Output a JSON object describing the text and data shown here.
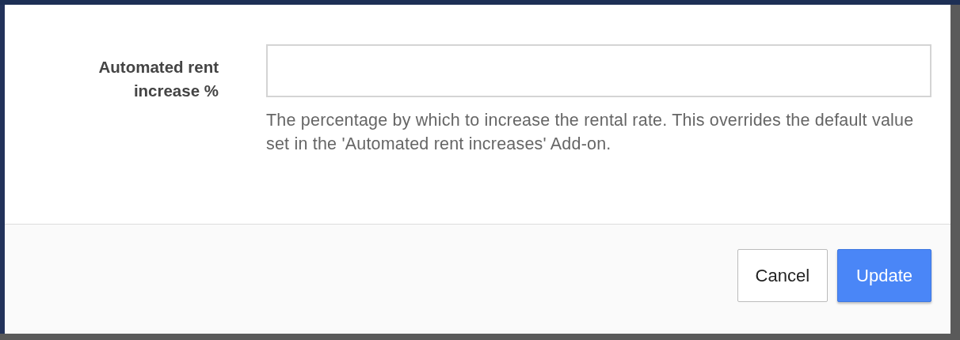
{
  "form": {
    "label": "Automated rent increase %",
    "help": "The percentage by which to increase the rental rate. This overrides the default value set in the 'Automated rent increases' Add-on."
  },
  "buttons": [
    {
      "label": "Cancel",
      "kind": "secondary"
    },
    {
      "label": "Update",
      "kind": "primary"
    }
  ]
}
